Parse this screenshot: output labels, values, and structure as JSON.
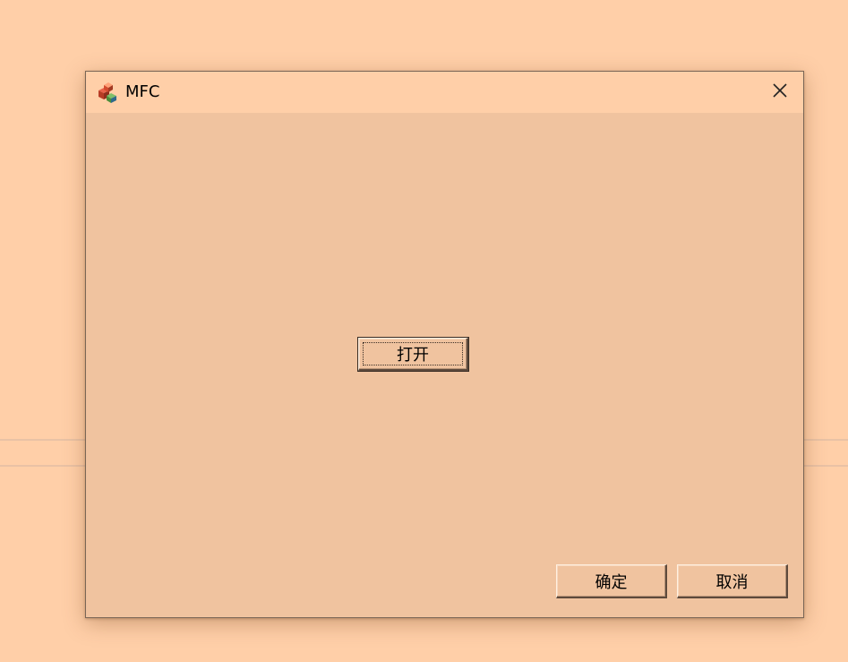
{
  "window": {
    "title": "MFC",
    "icon": "mfc-app-icon",
    "close_icon": "close-icon"
  },
  "dialog": {
    "open_button_label": "打开",
    "ok_button_label": "确定",
    "cancel_button_label": "取消"
  },
  "colors": {
    "desktop_background": "#ffcfa8",
    "dialog_background": "#f0c39f",
    "titlebar_background": "#ffcfa8"
  }
}
